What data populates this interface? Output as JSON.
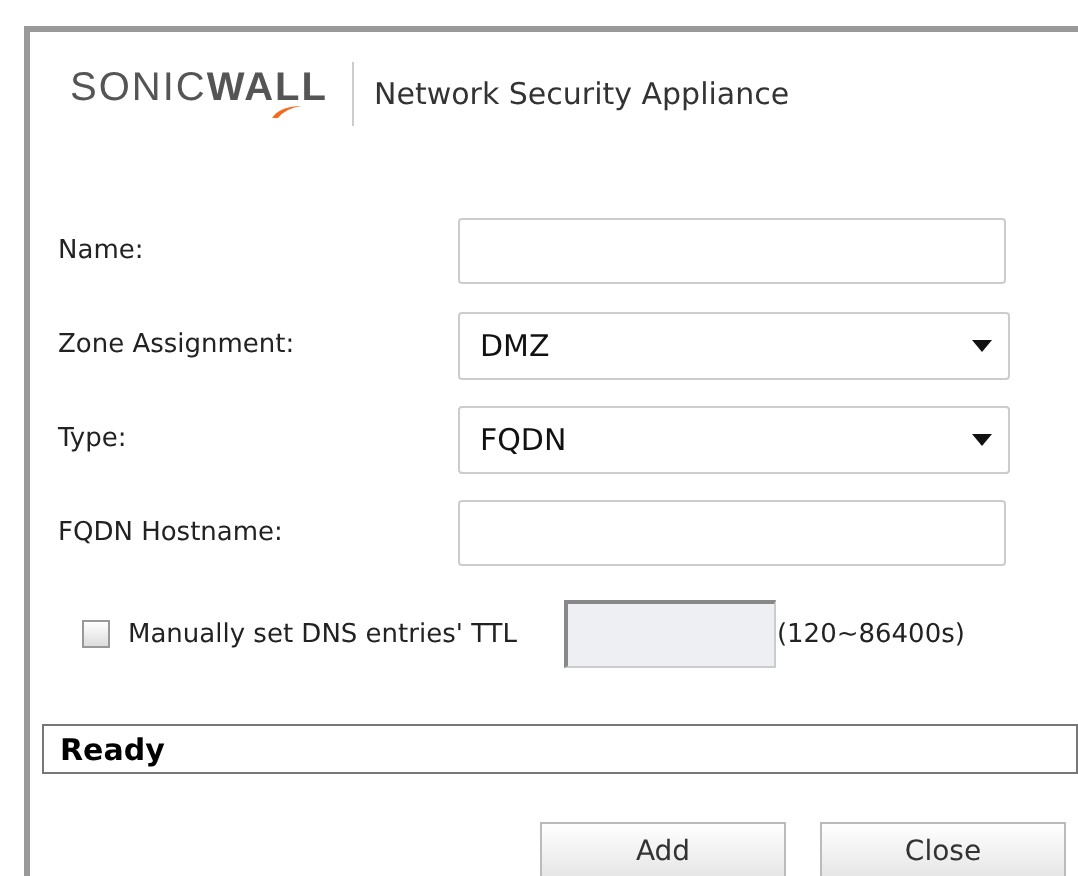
{
  "header": {
    "logo": "SONIC**WALL**",
    "title": "Network Security Appliance"
  },
  "fields": [
    {
      "kind": "text",
      "label": "Name:"
    },
    {
      "kind": "select",
      "label": "Zone Assignment:",
      "value": "DMZ"
    },
    {
      "kind": "select",
      "label": "Type:",
      "value": "FQDN"
    },
    {
      "kind": "text",
      "label": "FQDN Hostname:"
    }
  ],
  "ttl": {
    "label": "Manually set DNS entries' TTL",
    "checked": false,
    "disabled": true,
    "range": "(120~86400s)"
  },
  "status_bar": "Ready",
  "buttons": [
    "Add",
    "Close"
  ]
}
